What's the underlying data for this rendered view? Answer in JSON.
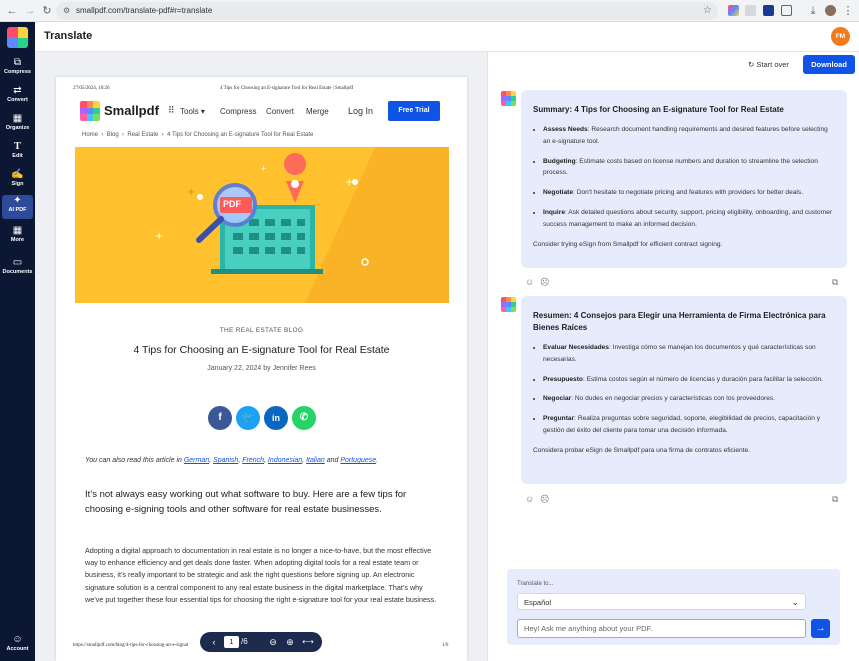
{
  "browser": {
    "url": "smallpdf.com/translate-pdf#r=translate"
  },
  "sidebar": {
    "items": [
      {
        "label": "Compress",
        "icon": "compress-icon"
      },
      {
        "label": "Convert",
        "icon": "convert-icon"
      },
      {
        "label": "Organize",
        "icon": "organize-icon"
      },
      {
        "label": "Edit",
        "icon": "edit-icon"
      },
      {
        "label": "Sign",
        "icon": "sign-icon"
      },
      {
        "label": "AI PDF",
        "icon": "ai-pdf-icon"
      },
      {
        "label": "More",
        "icon": "more-icon"
      },
      {
        "label": "Documents",
        "icon": "documents-icon"
      }
    ],
    "account": "Account"
  },
  "header": {
    "title": "Translate",
    "avatar": "FM"
  },
  "pdf": {
    "print_date": "27/05/2024, 10:26",
    "print_title": "4 Tips for Choosing an E-signature Tool for Real Estate | Smallpdf",
    "site_name": "Smallpdf",
    "nav": {
      "tools": "Tools",
      "compress": "Compress",
      "convert": "Convert",
      "merge": "Merge",
      "login": "Log In",
      "trial": "Free Trial"
    },
    "breadcrumb": [
      "Home",
      "Blog",
      "Real Estate",
      "4 Tips for Choosing an E-signature Tool for Real Estate"
    ],
    "hero_badge": "PDF",
    "kicker": "THE REAL ESTATE BLOG",
    "title": "4 Tips for Choosing an E-signature Tool for Real Estate",
    "date": "January 22, 2024 by Jennifer Rees",
    "langs_prefix": "You can also read this article in",
    "langs": [
      "German",
      "Spanish",
      "French",
      "Indonesian",
      "Italian",
      "Portuguese"
    ],
    "langs_and": "and",
    "intro": "It’s not always easy working out what software to buy. Here are a few tips for choosing e-signing tools and other software for real estate businesses.",
    "body": "Adopting a digital approach to documentation in real estate is no longer a nice-to-have, but the most effective way to enhance efficiency and get deals done faster. When adopting digital tools for a real estate team or business, it’s really important to be strategic and ask the right questions before signing up. An electronic signature solution is a central component to any real estate business in the digital marketplace. That’s why we’ve put together these four essential tips for choosing the right e-signature tool for your real estate business.",
    "footer_url": "https://smallpdf.com/blog/4-tips-for-choosing-an-e-signat",
    "footer_page": "1/6"
  },
  "pager": {
    "current": "1",
    "total": "/6"
  },
  "right": {
    "start_over": "Start over",
    "download": "Download",
    "summary_en": {
      "title": "Summary: 4 Tips for Choosing an E-signature Tool for Real Estate",
      "items": [
        {
          "term": "Assess Needs",
          "text": ": Research document handling requirements and desired features before selecting an e-signature tool."
        },
        {
          "term": "Budgeting",
          "text": ": Estimate costs based on license numbers and duration to streamline the selection process."
        },
        {
          "term": "Negotiate",
          "text": ": Don't hesitate to negotiate pricing and features with providers for better deals."
        },
        {
          "term": "Inquire",
          "text": ": Ask detailed questions about security, support, pricing eligibility, onboarding, and customer success management to make an informed decision."
        }
      ],
      "closing": "Consider trying eSign from Smallpdf for efficient contract signing."
    },
    "summary_es": {
      "title": "Resumen: 4 Consejos para Elegir una Herramienta de Firma Electrónica para Bienes Raíces",
      "items": [
        {
          "term": "Evaluar Necesidades",
          "text": ": Investiga cómo se manejan los documentos y qué características son necesarias."
        },
        {
          "term": "Presupuesto",
          "text": ": Estima costos según el número de licencias y duración para facilitar la selección."
        },
        {
          "term": "Negociar",
          "text": ": No dudes en negociar precios y características con los proveedores."
        },
        {
          "term": "Preguntar",
          "text": ": Realiza preguntas sobre seguridad, soporte, elegibilidad de precios, capacitación y gestión del éxito del cliente para tomar una decisión informada."
        }
      ],
      "closing": "Considera probar eSign de Smallpdf para una firma de contratos eficiente."
    },
    "translate_label": "Translate to...",
    "language": "Español",
    "ask_placeholder": "Hey! Ask me anything about your PDF."
  },
  "colors": {
    "accent": "#1053e7",
    "sidebar": "#0c1733",
    "card": "#e6ecfb",
    "hero": "#ffc22e"
  }
}
